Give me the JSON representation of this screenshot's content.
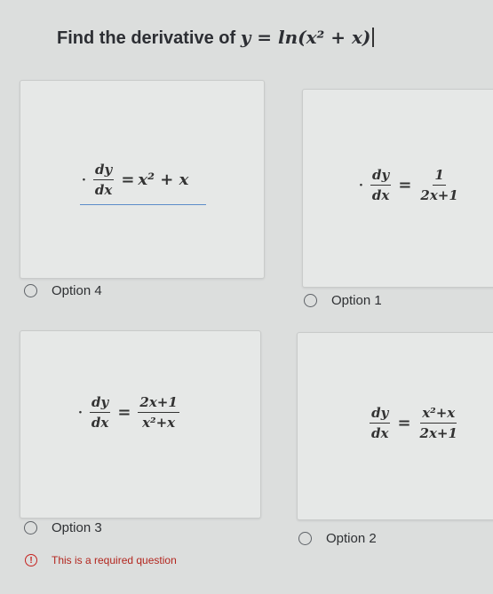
{
  "question": {
    "text": "Find the derivative of ",
    "expression": "y = ln(x² + x)"
  },
  "cards": [
    {
      "id": "card-a",
      "dot": "·",
      "num": "dy",
      "den": "dx",
      "op": "=",
      "rhs_text": "x² + x"
    },
    {
      "id": "card-b",
      "dot": "·",
      "num": "dy",
      "den": "dx",
      "op": "=",
      "rhs_num": "1",
      "rhs_den": "2x+1"
    },
    {
      "id": "card-c",
      "dot": "·",
      "num": "dy",
      "den": "dx",
      "op": "=",
      "rhs_num": "2x+1",
      "rhs_den": "x²+x"
    },
    {
      "id": "card-d",
      "num": "dy",
      "den": "dx",
      "op": "=",
      "rhs_num": "x²+x",
      "rhs_den": "2x+1"
    }
  ],
  "options": {
    "opt4": "Option 4",
    "opt1": "Option 1",
    "opt3": "Option 3",
    "opt2": "Option 2"
  },
  "required_message": "This is a required question",
  "colors": {
    "error": "#c5221f",
    "underline": "#5b8cc9"
  }
}
